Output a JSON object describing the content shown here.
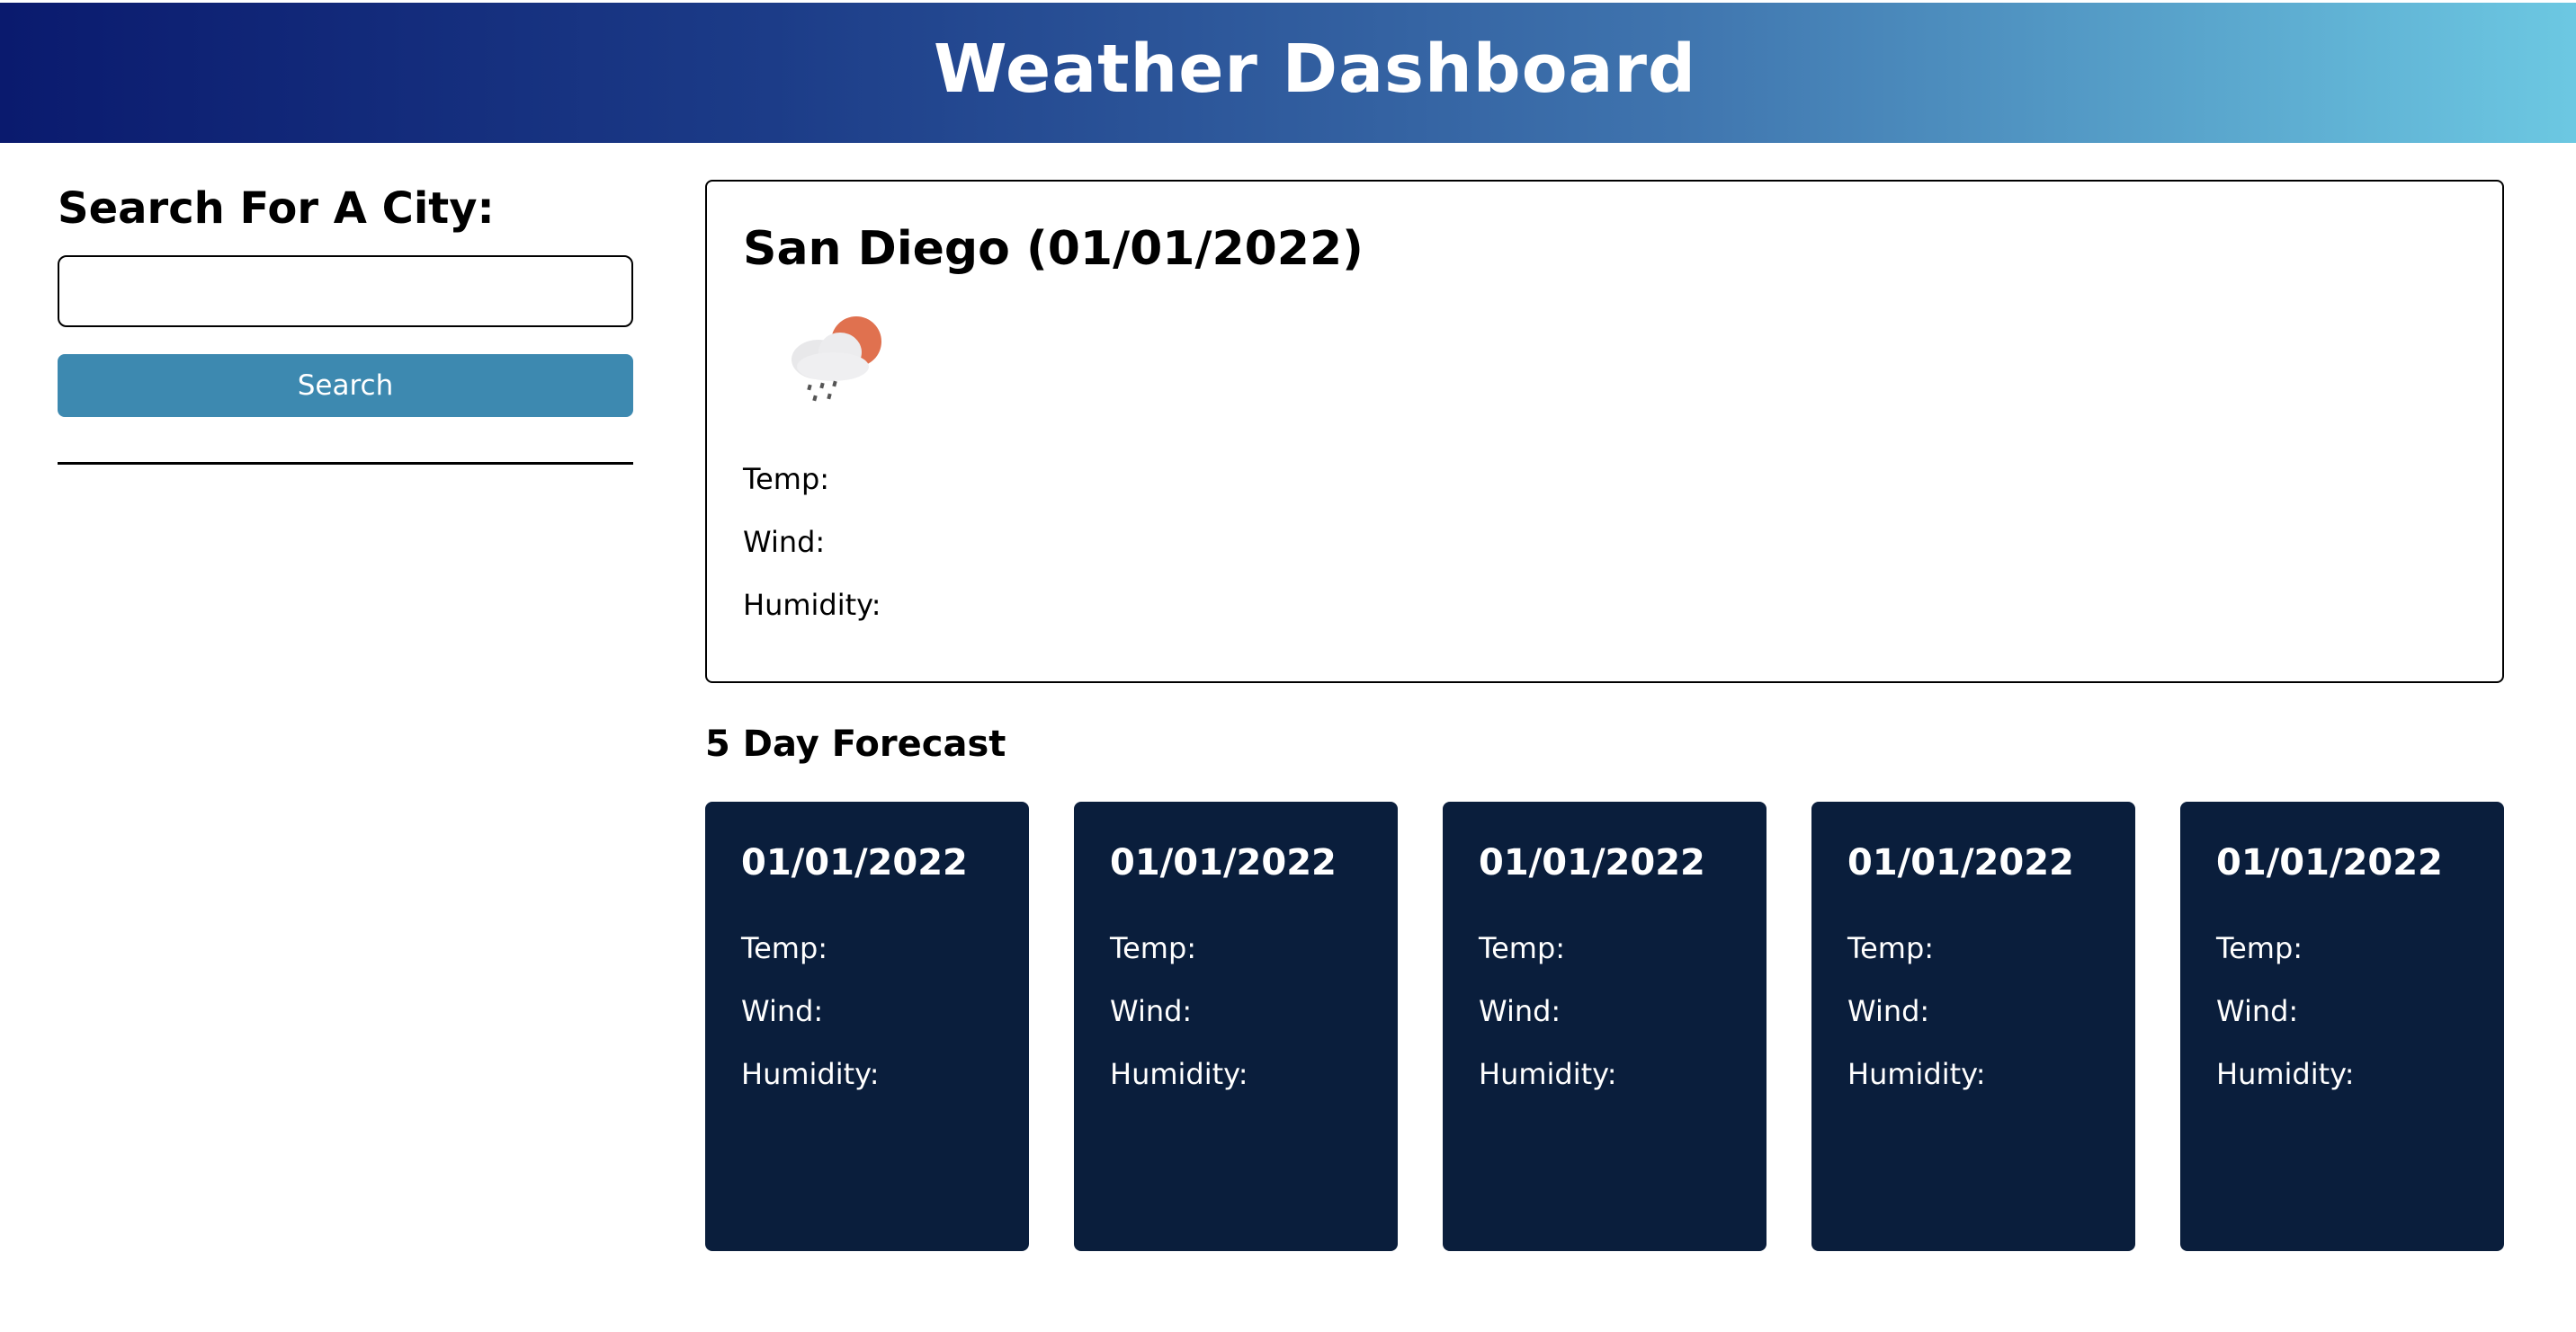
{
  "header": {
    "title": "Weather Dashboard"
  },
  "sidebar": {
    "heading": "Search For A City:",
    "search_value": "",
    "search_button_label": "Search"
  },
  "current": {
    "title": "San Diego (01/01/2022)",
    "icon": "rain-cloud-sun-icon",
    "temp_label": "Temp:",
    "wind_label": "Wind:",
    "humidity_label": "Humidity:"
  },
  "forecast": {
    "title": "5 Day Forecast",
    "days": [
      {
        "date": "01/01/2022",
        "temp_label": "Temp:",
        "wind_label": "Wind:",
        "humidity_label": "Humidity:"
      },
      {
        "date": "01/01/2022",
        "temp_label": "Temp:",
        "wind_label": "Wind:",
        "humidity_label": "Humidity:"
      },
      {
        "date": "01/01/2022",
        "temp_label": "Temp:",
        "wind_label": "Wind:",
        "humidity_label": "Humidity:"
      },
      {
        "date": "01/01/2022",
        "temp_label": "Temp:",
        "wind_label": "Wind:",
        "humidity_label": "Humidity:"
      },
      {
        "date": "01/01/2022",
        "temp_label": "Temp:",
        "wind_label": "Wind:",
        "humidity_label": "Humidity:"
      }
    ]
  },
  "colors": {
    "header_gradient_start": "#0a1a6e",
    "header_gradient_end": "#6cc8e2",
    "search_button": "#3d89b0",
    "forecast_card": "#0a1e3c"
  }
}
